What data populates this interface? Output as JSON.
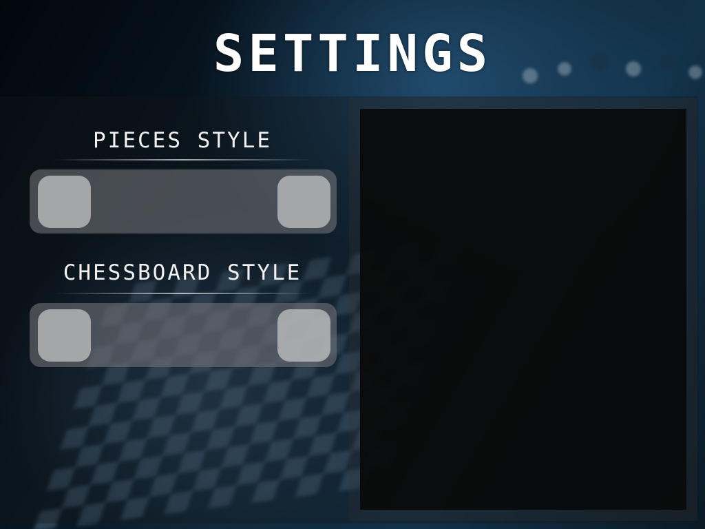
{
  "screen": {
    "title": "SETTINGS"
  },
  "pieces_style": {
    "label": "PIECES STYLE"
  },
  "chessboard_style": {
    "label": "CHESSBOARD STYLE"
  },
  "colors": {
    "title_text": "#ffffff",
    "label_text": "#f2f2f2",
    "selector_bg": "#6e7074",
    "selector_button": "#c8c8c8",
    "preview_bg": "#0a0a0a",
    "background_accent": "#12324a"
  }
}
